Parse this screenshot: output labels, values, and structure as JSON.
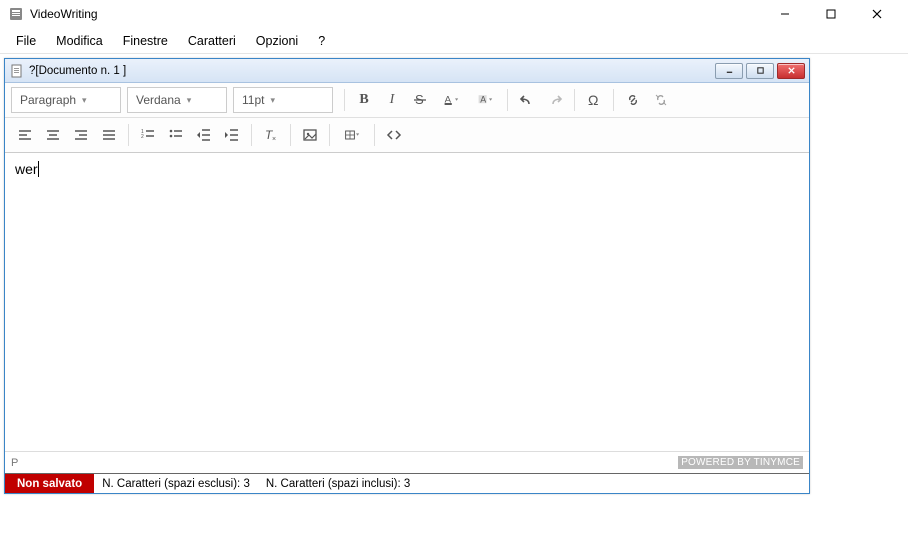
{
  "app": {
    "title": "VideoWriting"
  },
  "menu": {
    "file": "File",
    "modifica": "Modifica",
    "finestre": "Finestre",
    "caratteri": "Caratteri",
    "opzioni": "Opzioni",
    "help": "?"
  },
  "document": {
    "title": "?[Documento n. 1 ]"
  },
  "toolbar": {
    "paragraph": "Paragraph",
    "font": "Verdana",
    "size": "11pt",
    "bold": "B",
    "italic": "I"
  },
  "editor": {
    "content": "wer",
    "path": "P",
    "powered": "POWERED BY TINYMCE"
  },
  "status": {
    "unsaved": "Non salvato",
    "chars_excl_label": "N. Caratteri (spazi esclusi):",
    "chars_excl_value": "3",
    "chars_incl_label": "N. Caratteri (spazi inclusi):",
    "chars_incl_value": "3"
  }
}
